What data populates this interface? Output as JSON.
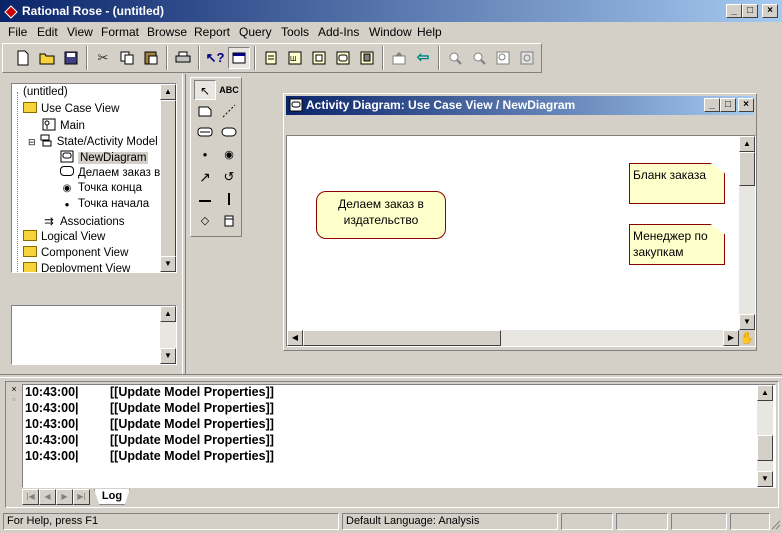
{
  "app": {
    "title": "Rational Rose - (untitled)",
    "window_buttons": [
      "_",
      "□",
      "×"
    ]
  },
  "menu": [
    "File",
    "Edit",
    "View",
    "Format",
    "Browse",
    "Report",
    "Query",
    "Tools",
    "Add-Ins",
    "Window",
    "Help"
  ],
  "toolbar_icons": [
    "new-icon",
    "open-icon",
    "save-icon",
    "cut-icon",
    "copy-icon",
    "paste-icon",
    "print-icon",
    "context-help-icon",
    "view-doc-icon",
    "class-diagram-icon",
    "interaction-diagram-icon",
    "component-diagram-icon",
    "state-diagram-icon",
    "deployment-diagram-icon",
    "parent-icon",
    "previous-icon",
    "zoom-in-icon",
    "zoom-out-icon",
    "fit-window-icon",
    "undo-fit-icon"
  ],
  "browser": {
    "items": [
      {
        "label": "(untitled)",
        "icon": "none"
      },
      {
        "label": "Use Case View",
        "icon": "folder"
      },
      {
        "label": "Main",
        "icon": "diagram"
      },
      {
        "label": "State/Activity Model",
        "icon": "state-model"
      },
      {
        "label": "NewDiagram",
        "icon": "activity-diagram"
      },
      {
        "label": "Делаем заказ в",
        "icon": "activity"
      },
      {
        "label": "Точка конца",
        "icon": "end-state"
      },
      {
        "label": "Точка начала",
        "icon": "start-state"
      },
      {
        "label": "Associations",
        "icon": "association"
      },
      {
        "label": "Logical View",
        "icon": "folder"
      },
      {
        "label": "Component View",
        "icon": "folder"
      },
      {
        "label": "Deployment View",
        "icon": "folder"
      }
    ]
  },
  "palette": {
    "items": [
      "selection-arrow-icon",
      "text-box-icon",
      "note-icon",
      "anchor-note-icon",
      "state-icon",
      "activity-icon",
      "start-state-icon",
      "end-state-icon",
      "transition-icon",
      "self-transition-icon",
      "horizontal-sync-icon",
      "vertical-sync-icon",
      "decision-icon",
      "swimlane-icon"
    ],
    "text_label": "ABC"
  },
  "diagram_window": {
    "title": "Activity Diagram: Use Case View / NewDiagram",
    "activity": {
      "label": "Делаем заказ в издательство"
    },
    "notes": [
      {
        "label": "Бланк заказа"
      },
      {
        "label": "Менеджер по закупкам"
      }
    ]
  },
  "log": {
    "lines": [
      {
        "time": "10:43:00|",
        "text": "[[Update Model Properties]]"
      },
      {
        "time": "10:43:00|",
        "text": "[[Update Model Properties]]"
      },
      {
        "time": "10:43:00|",
        "text": "[[Update Model Properties]]"
      },
      {
        "time": "10:43:00|",
        "text": "[[Update Model Properties]]"
      },
      {
        "time": "10:43:00|",
        "text": "[[Update Model Properties]]"
      }
    ],
    "tab_label": "Log"
  },
  "status": {
    "help": "For Help, press F1",
    "language": "Default Language: Analysis"
  }
}
